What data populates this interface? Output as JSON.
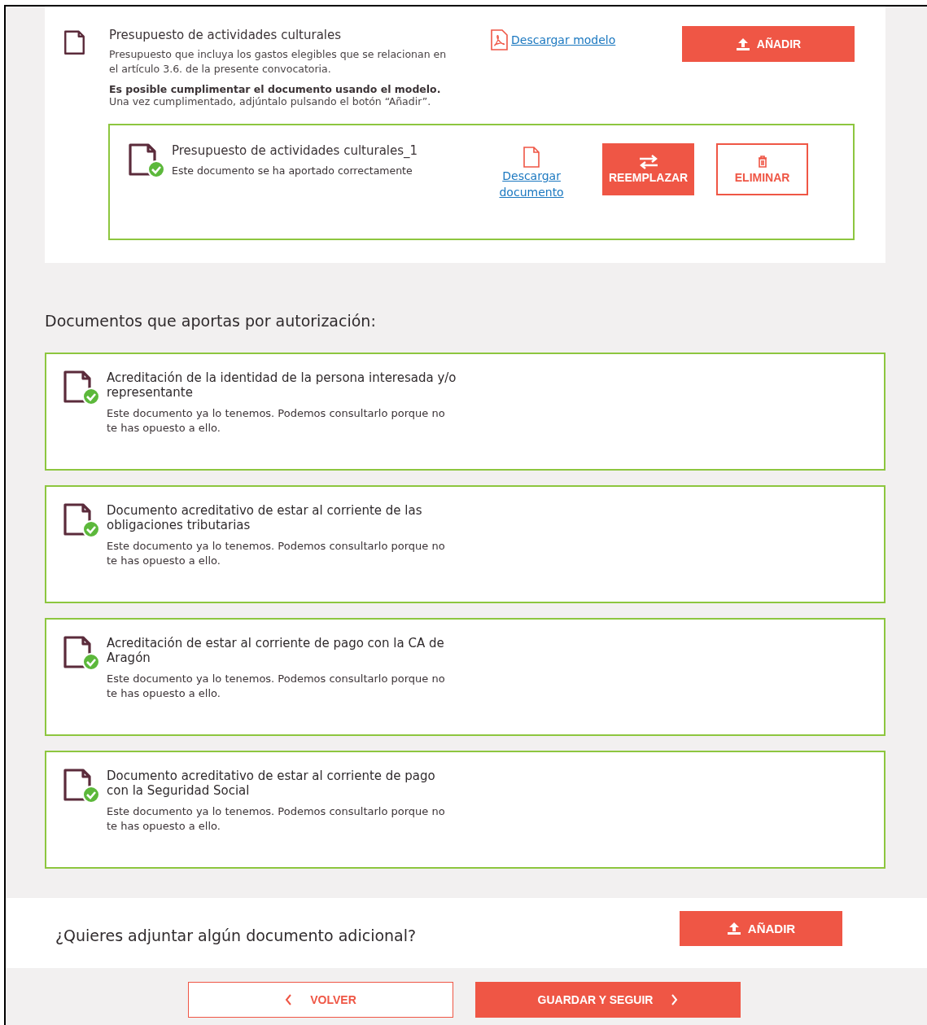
{
  "required_document": {
    "title": "Presupuesto de actividades culturales",
    "description": "Presupuesto que incluya los gastos elegibles que se relacionan en el artículo 3.6. de la presente convocatoria.",
    "note_bold": "Es posible cumplimentar el documento usando el modelo.",
    "note": "Una vez cumplimentado, adjúntalo pulsando el botón “Añadir”.",
    "download_link": "Descargar modelo",
    "add_button": "AÑADIR"
  },
  "uploaded_file": {
    "name": "Presupuesto de actividades culturales_1",
    "status": "Este documento se ha aportado correctamente",
    "verified": true,
    "download_link": "Descargar documento",
    "replace_button": "REEMPLAZAR",
    "delete_button": "ELIMINAR"
  },
  "authorization_section": {
    "heading": "Documentos que aportas por autorización:",
    "documents": [
      {
        "title": "Acreditación de la identidad de la persona interesada y/o representante",
        "status": "Este documento ya lo tenemos. Podemos consultarlo porque no te has opuesto a ello.",
        "verified": true
      },
      {
        "title": "Documento acreditativo de estar al corriente de las obligaciones tributarias",
        "status": "Este documento ya lo tenemos. Podemos consultarlo porque no te has opuesto a ello.",
        "verified": true
      },
      {
        "title": "Acreditación de estar al corriente de pago con la CA de Aragón",
        "status": "Este documento ya lo tenemos. Podemos consultarlo porque no te has opuesto a ello.",
        "verified": true
      },
      {
        "title": "Documento acreditativo de estar al corriente de pago con la Seguridad Social",
        "status": "Este documento ya lo tenemos. Podemos consultarlo porque no te has opuesto a ello.",
        "verified": true
      }
    ]
  },
  "additional": {
    "question": "¿Quieres adjuntar algún documento adicional?",
    "add_button": "AÑADIR"
  },
  "footer": {
    "back_button": "VOLVER",
    "continue_button": "GUARDAR Y SEGUIR"
  }
}
